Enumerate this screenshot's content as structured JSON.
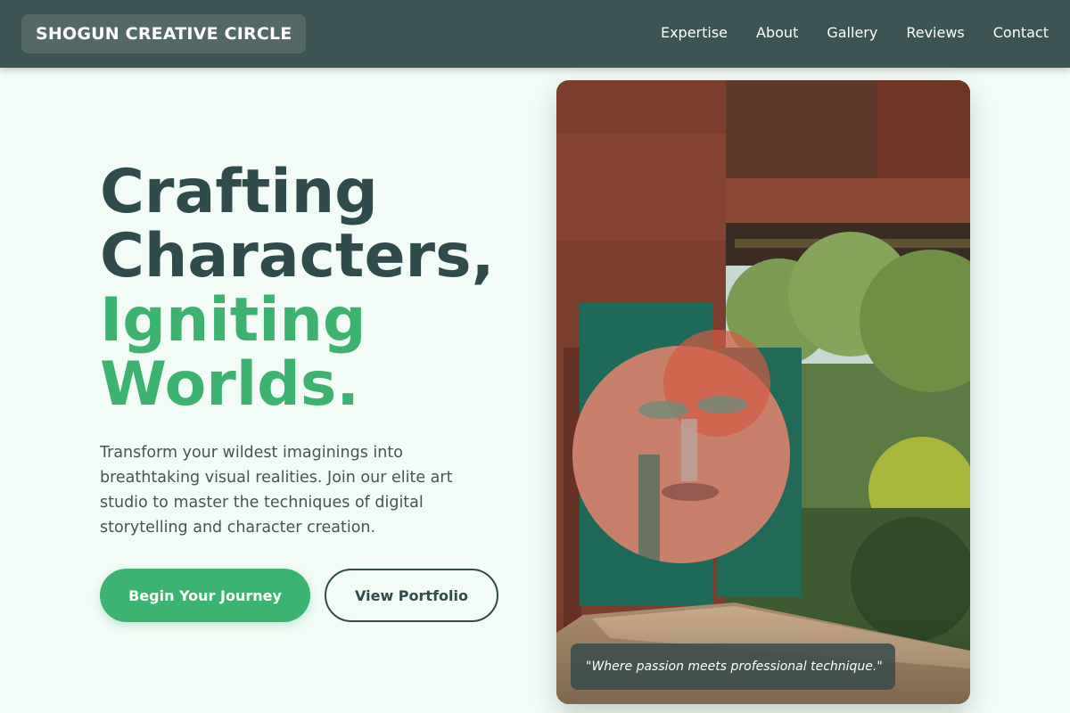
{
  "brand": {
    "name": "SHOGUN CREATIVE CIRCLE"
  },
  "nav": {
    "items": [
      {
        "label": "Expertise"
      },
      {
        "label": "About"
      },
      {
        "label": "Gallery"
      },
      {
        "label": "Reviews"
      },
      {
        "label": "Contact"
      }
    ]
  },
  "hero": {
    "title_line1": "Crafting",
    "title_line2": "Characters,",
    "title_accent_line1": "Igniting",
    "title_accent_line2": "Worlds.",
    "subtitle": "Transform your wildest imaginings into breathtaking visual realities. Join our elite art studio to master the techniques of digital storytelling and character creation.",
    "primary_cta": "Begin Your Journey",
    "secondary_cta": "View Portfolio",
    "quote": "\"Where passion meets professional technique.\""
  },
  "colors": {
    "header_bg": "#3d5454",
    "accent": "#3cb371",
    "heading": "#2f4b4b",
    "page_bg": "#f2fbf6"
  }
}
